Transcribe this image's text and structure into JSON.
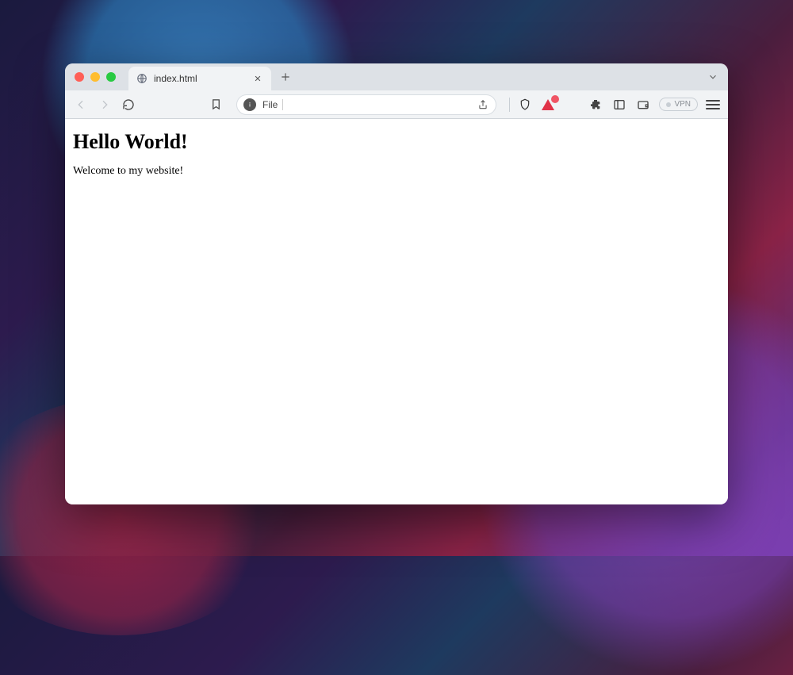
{
  "tab": {
    "title": "index.html"
  },
  "address": {
    "scheme": "File"
  },
  "toolbar": {
    "vpn_label": "VPN"
  },
  "page": {
    "heading": "Hello World!",
    "paragraph": "Welcome to my website!"
  }
}
